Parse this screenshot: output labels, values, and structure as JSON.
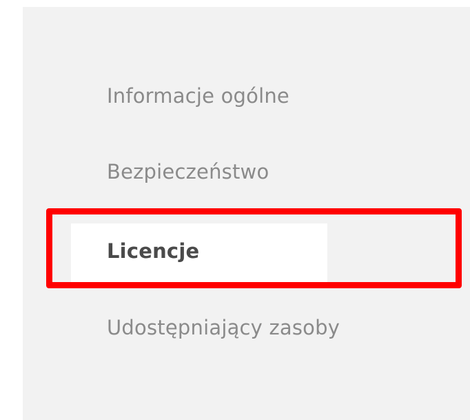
{
  "nav": {
    "items": [
      {
        "label": "Informacje ogólne",
        "active": false
      },
      {
        "label": "Bezpieczeństwo",
        "active": false
      },
      {
        "label": "Licencje",
        "active": true
      },
      {
        "label": "Udostępniający zasoby",
        "active": false
      }
    ]
  },
  "colors": {
    "highlight": "#ff0000",
    "panel_background": "#f2f2f2",
    "inactive_text": "#8a8a8a",
    "active_text": "#4a4a4a"
  }
}
